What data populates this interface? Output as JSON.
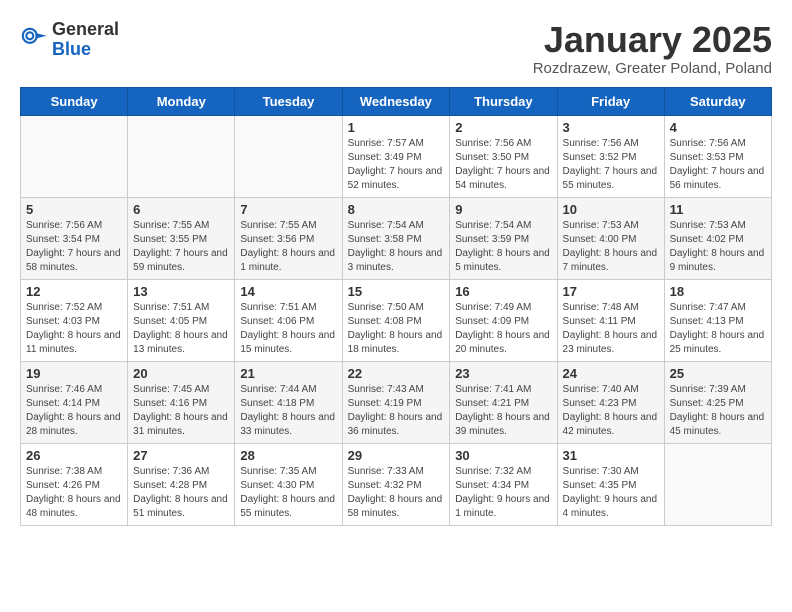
{
  "header": {
    "logo_general": "General",
    "logo_blue": "Blue",
    "month_title": "January 2025",
    "location": "Rozdrazew, Greater Poland, Poland"
  },
  "weekdays": [
    "Sunday",
    "Monday",
    "Tuesday",
    "Wednesday",
    "Thursday",
    "Friday",
    "Saturday"
  ],
  "weeks": [
    [
      {
        "day": "",
        "content": ""
      },
      {
        "day": "",
        "content": ""
      },
      {
        "day": "",
        "content": ""
      },
      {
        "day": "1",
        "content": "Sunrise: 7:57 AM\nSunset: 3:49 PM\nDaylight: 7 hours and 52 minutes."
      },
      {
        "day": "2",
        "content": "Sunrise: 7:56 AM\nSunset: 3:50 PM\nDaylight: 7 hours and 54 minutes."
      },
      {
        "day": "3",
        "content": "Sunrise: 7:56 AM\nSunset: 3:52 PM\nDaylight: 7 hours and 55 minutes."
      },
      {
        "day": "4",
        "content": "Sunrise: 7:56 AM\nSunset: 3:53 PM\nDaylight: 7 hours and 56 minutes."
      }
    ],
    [
      {
        "day": "5",
        "content": "Sunrise: 7:56 AM\nSunset: 3:54 PM\nDaylight: 7 hours and 58 minutes."
      },
      {
        "day": "6",
        "content": "Sunrise: 7:55 AM\nSunset: 3:55 PM\nDaylight: 7 hours and 59 minutes."
      },
      {
        "day": "7",
        "content": "Sunrise: 7:55 AM\nSunset: 3:56 PM\nDaylight: 8 hours and 1 minute."
      },
      {
        "day": "8",
        "content": "Sunrise: 7:54 AM\nSunset: 3:58 PM\nDaylight: 8 hours and 3 minutes."
      },
      {
        "day": "9",
        "content": "Sunrise: 7:54 AM\nSunset: 3:59 PM\nDaylight: 8 hours and 5 minutes."
      },
      {
        "day": "10",
        "content": "Sunrise: 7:53 AM\nSunset: 4:00 PM\nDaylight: 8 hours and 7 minutes."
      },
      {
        "day": "11",
        "content": "Sunrise: 7:53 AM\nSunset: 4:02 PM\nDaylight: 8 hours and 9 minutes."
      }
    ],
    [
      {
        "day": "12",
        "content": "Sunrise: 7:52 AM\nSunset: 4:03 PM\nDaylight: 8 hours and 11 minutes."
      },
      {
        "day": "13",
        "content": "Sunrise: 7:51 AM\nSunset: 4:05 PM\nDaylight: 8 hours and 13 minutes."
      },
      {
        "day": "14",
        "content": "Sunrise: 7:51 AM\nSunset: 4:06 PM\nDaylight: 8 hours and 15 minutes."
      },
      {
        "day": "15",
        "content": "Sunrise: 7:50 AM\nSunset: 4:08 PM\nDaylight: 8 hours and 18 minutes."
      },
      {
        "day": "16",
        "content": "Sunrise: 7:49 AM\nSunset: 4:09 PM\nDaylight: 8 hours and 20 minutes."
      },
      {
        "day": "17",
        "content": "Sunrise: 7:48 AM\nSunset: 4:11 PM\nDaylight: 8 hours and 23 minutes."
      },
      {
        "day": "18",
        "content": "Sunrise: 7:47 AM\nSunset: 4:13 PM\nDaylight: 8 hours and 25 minutes."
      }
    ],
    [
      {
        "day": "19",
        "content": "Sunrise: 7:46 AM\nSunset: 4:14 PM\nDaylight: 8 hours and 28 minutes."
      },
      {
        "day": "20",
        "content": "Sunrise: 7:45 AM\nSunset: 4:16 PM\nDaylight: 8 hours and 31 minutes."
      },
      {
        "day": "21",
        "content": "Sunrise: 7:44 AM\nSunset: 4:18 PM\nDaylight: 8 hours and 33 minutes."
      },
      {
        "day": "22",
        "content": "Sunrise: 7:43 AM\nSunset: 4:19 PM\nDaylight: 8 hours and 36 minutes."
      },
      {
        "day": "23",
        "content": "Sunrise: 7:41 AM\nSunset: 4:21 PM\nDaylight: 8 hours and 39 minutes."
      },
      {
        "day": "24",
        "content": "Sunrise: 7:40 AM\nSunset: 4:23 PM\nDaylight: 8 hours and 42 minutes."
      },
      {
        "day": "25",
        "content": "Sunrise: 7:39 AM\nSunset: 4:25 PM\nDaylight: 8 hours and 45 minutes."
      }
    ],
    [
      {
        "day": "26",
        "content": "Sunrise: 7:38 AM\nSunset: 4:26 PM\nDaylight: 8 hours and 48 minutes."
      },
      {
        "day": "27",
        "content": "Sunrise: 7:36 AM\nSunset: 4:28 PM\nDaylight: 8 hours and 51 minutes."
      },
      {
        "day": "28",
        "content": "Sunrise: 7:35 AM\nSunset: 4:30 PM\nDaylight: 8 hours and 55 minutes."
      },
      {
        "day": "29",
        "content": "Sunrise: 7:33 AM\nSunset: 4:32 PM\nDaylight: 8 hours and 58 minutes."
      },
      {
        "day": "30",
        "content": "Sunrise: 7:32 AM\nSunset: 4:34 PM\nDaylight: 9 hours and 1 minute."
      },
      {
        "day": "31",
        "content": "Sunrise: 7:30 AM\nSunset: 4:35 PM\nDaylight: 9 hours and 4 minutes."
      },
      {
        "day": "",
        "content": ""
      }
    ]
  ]
}
